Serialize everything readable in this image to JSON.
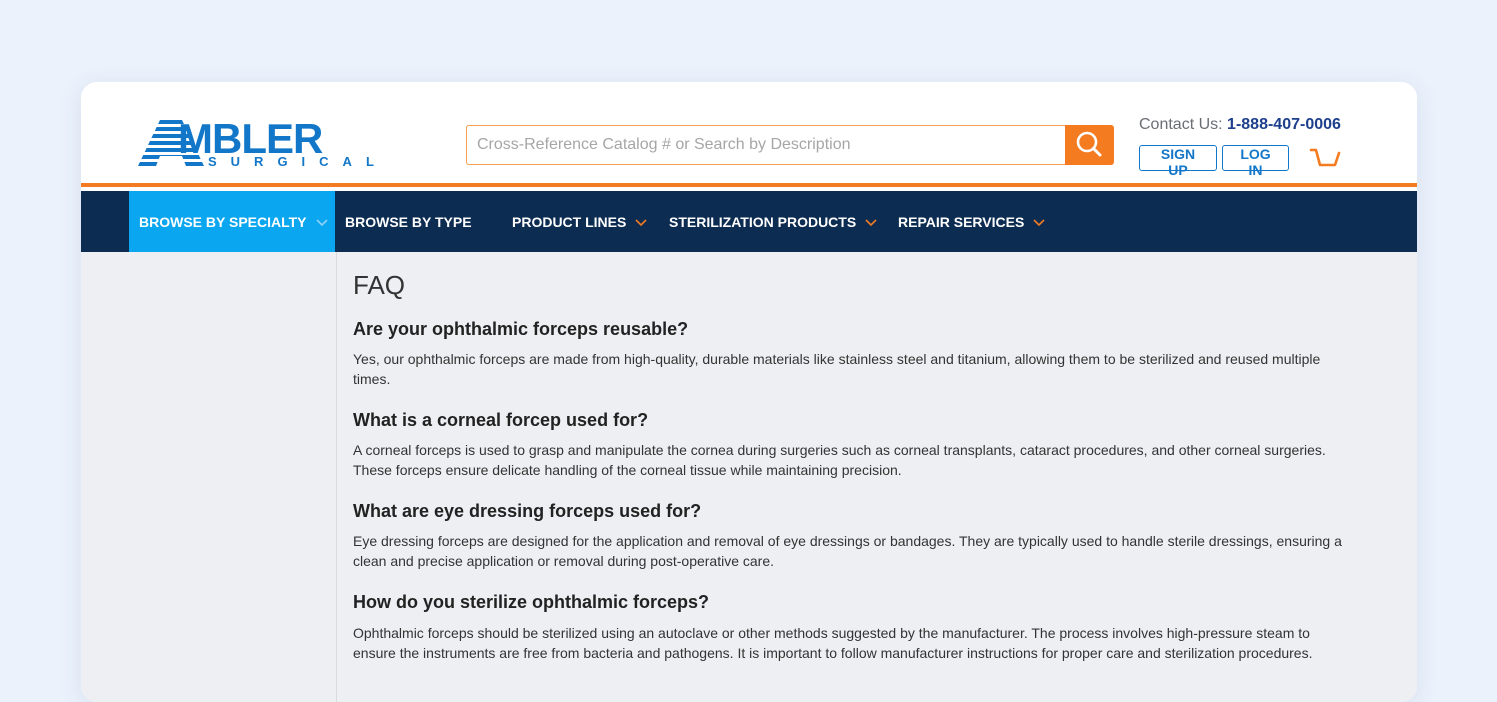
{
  "header": {
    "logo_word": "MBLER",
    "logo_sub": "SURGICAL",
    "search_placeholder": "Cross-Reference Catalog # or Search by Description",
    "contact_label": "Contact Us:",
    "contact_phone": "1-888-407-0006",
    "signup_label": "SIGN UP",
    "login_label": "LOG IN",
    "accent_color": "#f47b20",
    "brand_color": "#1377c9"
  },
  "nav": {
    "items": [
      {
        "label": "BROWSE BY SPECIALTY",
        "has_dropdown": true,
        "active": true
      },
      {
        "label": "BROWSE BY TYPE",
        "has_dropdown": false,
        "active": false
      },
      {
        "label": "PRODUCT LINES",
        "has_dropdown": true,
        "active": false
      },
      {
        "label": "STERILIZATION PRODUCTS",
        "has_dropdown": true,
        "active": false
      },
      {
        "label": "REPAIR SERVICES",
        "has_dropdown": true,
        "active": false
      }
    ]
  },
  "faq": {
    "title": "FAQ",
    "items": [
      {
        "question": "Are your ophthalmic forceps reusable?",
        "answer": "Yes, our ophthalmic forceps are made from high-quality, durable materials like stainless steel and titanium, allowing them to be sterilized and reused multiple times."
      },
      {
        "question": "What is a corneal forcep used for?",
        "answer": "A corneal forceps is used to grasp and manipulate the cornea during surgeries such as corneal transplants, cataract procedures, and other corneal surgeries. These forceps ensure delicate handling of the corneal tissue while maintaining precision."
      },
      {
        "question": "What are eye dressing forceps used for?",
        "answer": "Eye dressing forceps are designed for the application and removal of eye dressings or bandages. They are typically used to handle sterile dressings, ensuring a clean and precise application or removal during post-operative care."
      },
      {
        "question": "How do you sterilize ophthalmic forceps?",
        "answer": "Ophthalmic forceps should be sterilized using an autoclave or other methods suggested by the manufacturer. The process involves high-pressure steam to ensure the instruments are free from bacteria and pathogens. It is important to follow manufacturer instructions for proper care and sterilization procedures."
      }
    ]
  }
}
